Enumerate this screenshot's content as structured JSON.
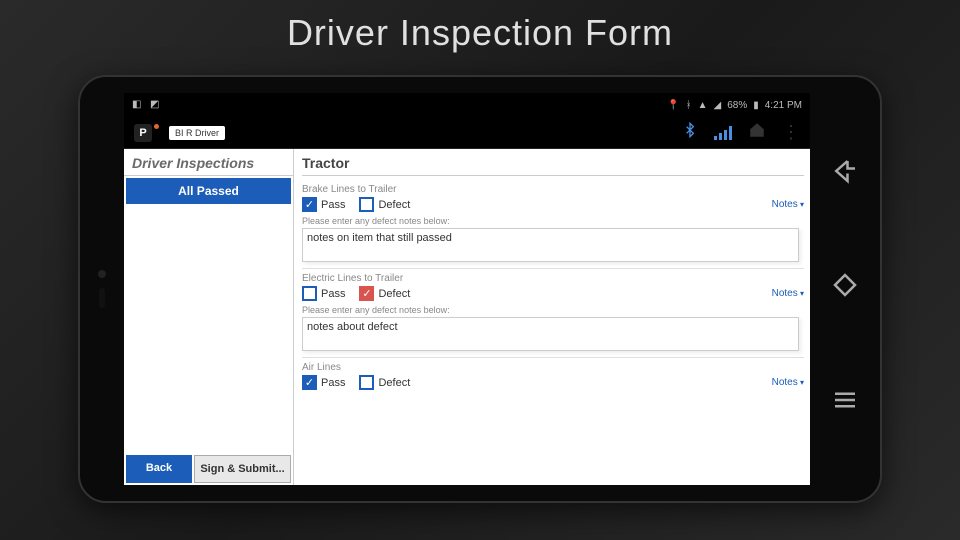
{
  "slide": {
    "title": "Driver Inspection Form"
  },
  "status": {
    "battery": "68%",
    "time": "4:21 PM"
  },
  "appbar": {
    "logo_letter": "P",
    "driver_label": "BI R Driver"
  },
  "sidebar": {
    "title": "Driver Inspections",
    "all_passed": "All Passed",
    "back": "Back",
    "sign": "Sign & Submit..."
  },
  "main": {
    "section": "Tractor",
    "notes_label": "Notes",
    "prompt": "Please enter any defect notes below:",
    "items": [
      {
        "label": "Brake Lines to Trailer",
        "pass_label": "Pass",
        "defect_label": "Defect",
        "pass_checked": true,
        "defect_checked": false,
        "notes": "notes on item that still passed"
      },
      {
        "label": "Electric Lines to Trailer",
        "pass_label": "Pass",
        "defect_label": "Defect",
        "pass_checked": false,
        "defect_checked": true,
        "notes": "notes about defect"
      },
      {
        "label": "Air Lines",
        "pass_label": "Pass",
        "defect_label": "Defect",
        "pass_checked": true,
        "defect_checked": false,
        "notes": ""
      }
    ]
  }
}
